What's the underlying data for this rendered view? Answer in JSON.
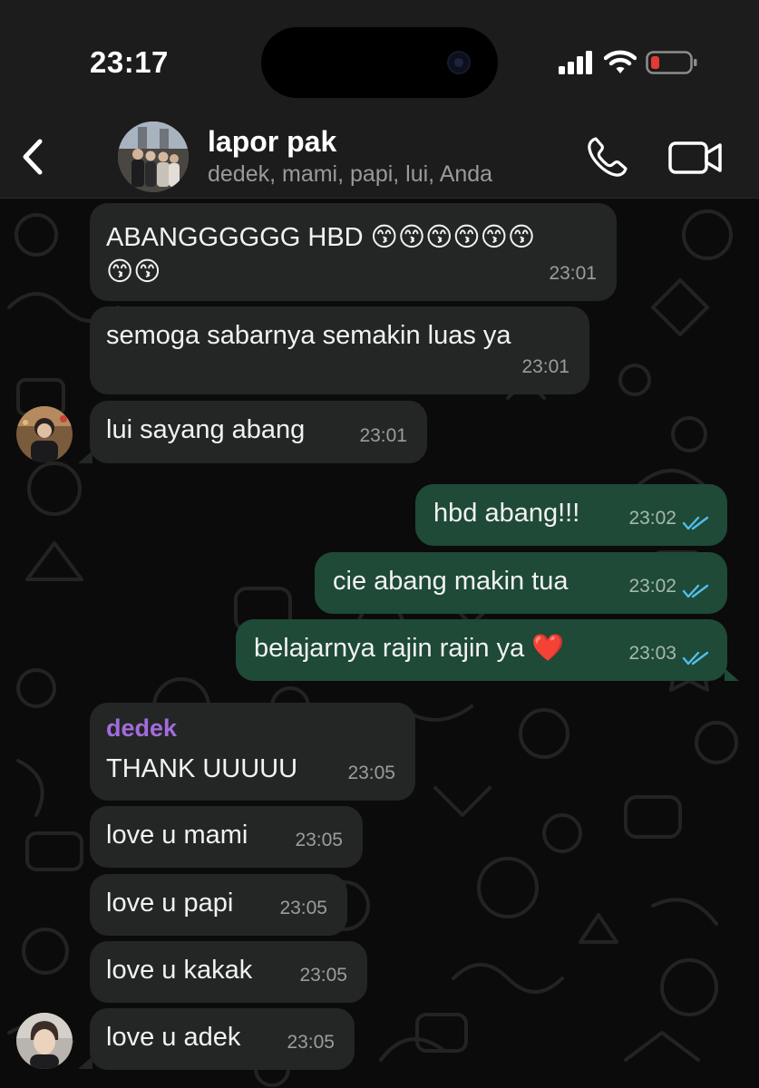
{
  "status_bar": {
    "time": "23:17"
  },
  "header": {
    "title": "lapor pak",
    "members": "dedek, mami, papi, lui, Anda"
  },
  "colors": {
    "incoming_bubble": "#242626",
    "outgoing_bubble": "#1e4a37",
    "read_ticks": "#53bdeb",
    "sender_dedek": "#a36bdd",
    "battery_low": "#e53935"
  },
  "messages": [
    {
      "direction": "in",
      "text_line1": "ABANGGGGGG HBD 😙😙😙😙😙😙",
      "text_line2": "😙😙",
      "time": "23:01"
    },
    {
      "direction": "in",
      "text": "semoga sabarnya semakin luas ya",
      "time": "23:01"
    },
    {
      "direction": "in",
      "text": "lui sayang abang",
      "time": "23:01"
    },
    {
      "direction": "out",
      "text": "hbd abang!!!",
      "time": "23:02",
      "status": "read"
    },
    {
      "direction": "out",
      "text": "cie abang makin tua",
      "time": "23:02",
      "status": "read"
    },
    {
      "direction": "out",
      "text": "belajarnya rajin rajin ya ❤️",
      "time": "23:03",
      "status": "read"
    },
    {
      "direction": "in",
      "sender": "dedek",
      "text": "THANK UUUUU",
      "time": "23:05"
    },
    {
      "direction": "in",
      "text": "love u mami",
      "time": "23:05"
    },
    {
      "direction": "in",
      "text": "love u papi",
      "time": "23:05"
    },
    {
      "direction": "in",
      "text": "love u kakak",
      "time": "23:05"
    },
    {
      "direction": "in",
      "text": "love u adek",
      "time": "23:05"
    }
  ]
}
